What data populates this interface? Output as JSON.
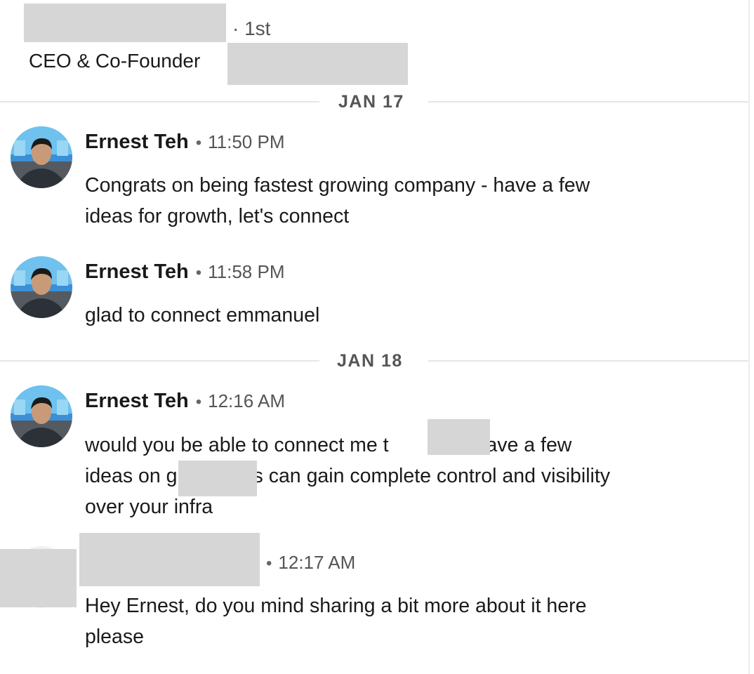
{
  "header": {
    "degree": "· 1st",
    "headline": "CEO & Co-Founder"
  },
  "dates": {
    "first": "JAN 17",
    "second": "JAN 18"
  },
  "messages": [
    {
      "sender": "Ernest Teh",
      "separator": "•",
      "time": "11:50 PM",
      "lines": [
        "Congrats on being fastest growing company - have a few",
        "ideas for growth, let's connect"
      ]
    },
    {
      "sender": "Ernest Teh",
      "separator": "•",
      "time": "11:58 PM",
      "lines": [
        "glad to connect emmanuel"
      ]
    },
    {
      "sender": "Ernest Teh",
      "separator": "•",
      "time": "12:16 AM",
      "lines": [
        "would you be able to connect me t",
        "v? have a few",
        "ideas on g",
        "s can gain complete control and visibility",
        "over your infra"
      ]
    },
    {
      "separator": "•",
      "time": "12:17 AM",
      "lines": [
        "Hey Ernest, do you mind sharing a bit more about it here",
        "please"
      ]
    }
  ],
  "colors": {
    "redaction": "#d6d6d6",
    "avatar_bg": "#3a8fd6"
  },
  "icons": {
    "avatar": "profile-photo"
  }
}
